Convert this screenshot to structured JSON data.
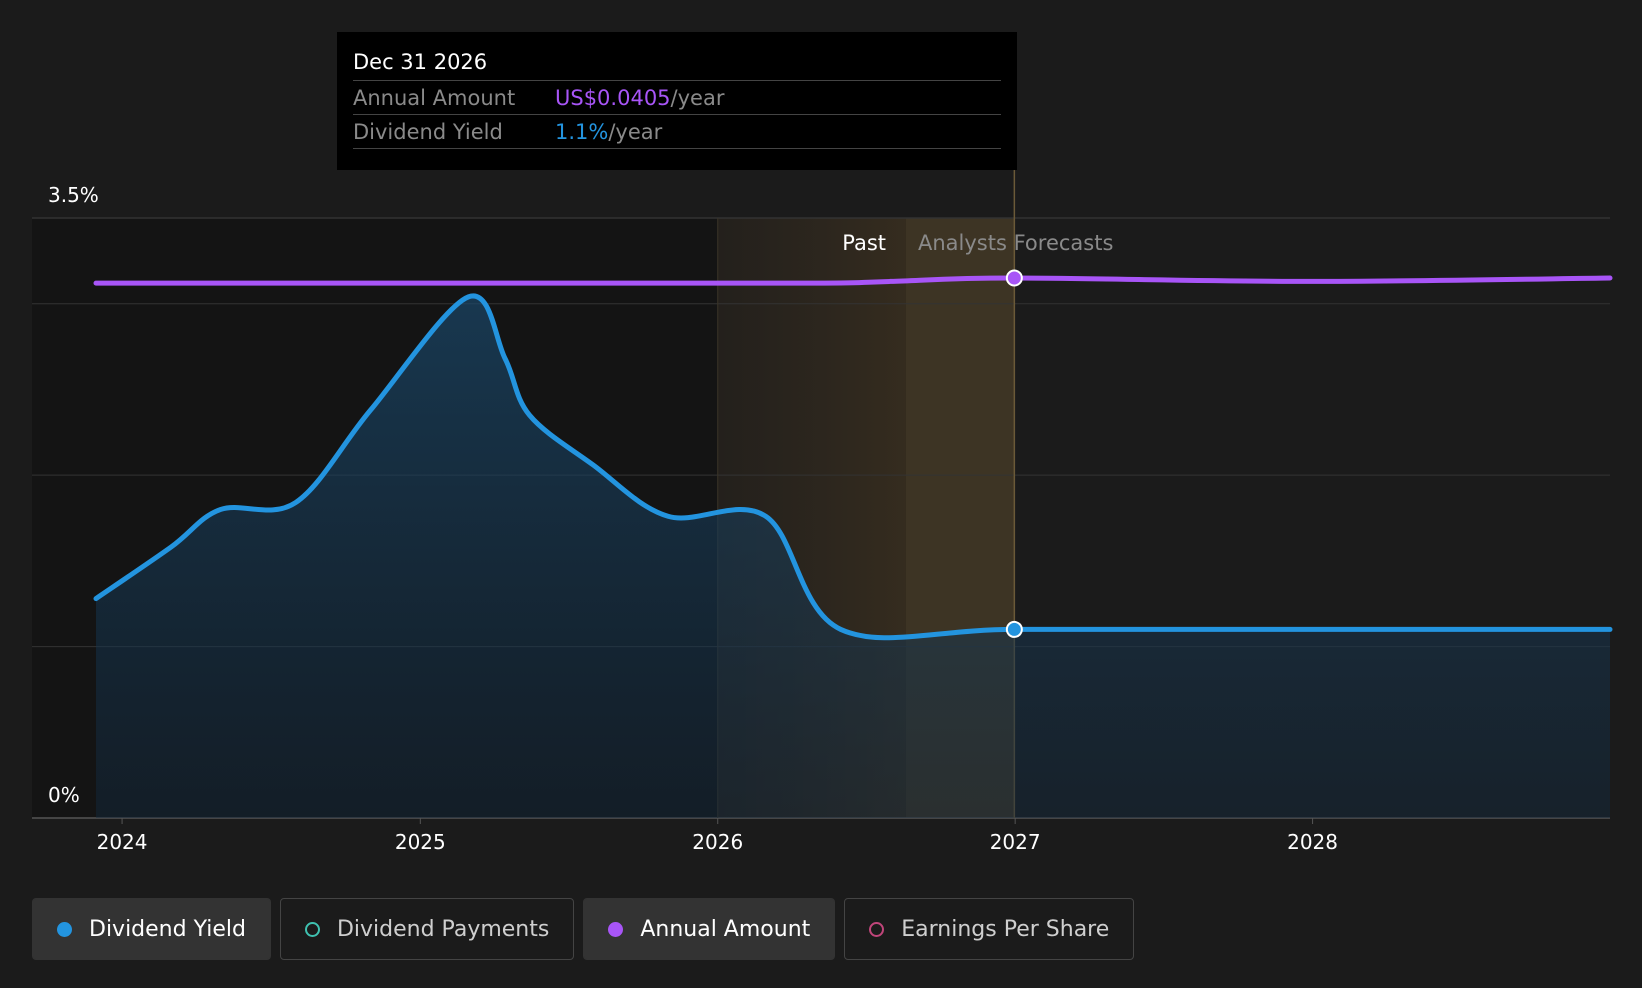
{
  "tooltip": {
    "date": "Dec 31 2026",
    "rows": [
      {
        "label": "Annual Amount",
        "value": "US$0.0405",
        "unit": "/year"
      },
      {
        "label": "Dividend Yield",
        "value": "1.1%",
        "unit": "/year"
      }
    ]
  },
  "regions": {
    "past_label": "Past",
    "forecast_label": "Analysts Forecasts"
  },
  "legend": [
    {
      "label": "Dividend Yield",
      "color": "#2394df",
      "filled": true,
      "active": true
    },
    {
      "label": "Dividend Payments",
      "color": "#3fc1b0",
      "filled": false,
      "active": false
    },
    {
      "label": "Annual Amount",
      "color": "#a855f7",
      "filled": true,
      "active": true
    },
    {
      "label": "Earnings Per Share",
      "color": "#c0457a",
      "filled": false,
      "active": false
    }
  ],
  "chart_data": {
    "type": "line",
    "y_axis": {
      "min": 0,
      "max": 3.5,
      "tick_labels": [
        "3.5%",
        "0%"
      ]
    },
    "x_axis": {
      "tick_labels": [
        "2024",
        "2025",
        "2026",
        "2027",
        "2028"
      ]
    },
    "x_range": [
      "2023-11-30",
      "2028-12-31"
    ],
    "past_cutoff": "2026-08-20",
    "forecast_highlight_end": "2026-12-31",
    "series": [
      {
        "name": "Dividend Yield",
        "color": "#2394df",
        "points": [
          [
            "2023-11-30",
            1.28
          ],
          [
            "2024-03-01",
            1.58
          ],
          [
            "2024-05-01",
            1.8
          ],
          [
            "2024-08-01",
            1.84
          ],
          [
            "2024-11-01",
            2.38
          ],
          [
            "2025-03-01",
            3.04
          ],
          [
            "2025-04-15",
            2.68
          ],
          [
            "2025-05-15",
            2.35
          ],
          [
            "2025-08-01",
            2.06
          ],
          [
            "2025-11-01",
            1.76
          ],
          [
            "2026-03-01",
            1.76
          ],
          [
            "2026-06-01",
            1.1
          ],
          [
            "2026-12-31",
            1.1
          ],
          [
            "2027-12-31",
            1.1
          ],
          [
            "2028-12-31",
            1.1
          ]
        ]
      },
      {
        "name": "Annual Amount",
        "color": "#a855f7",
        "points": [
          [
            "2023-11-30",
            3.12
          ],
          [
            "2025-06-01",
            3.12
          ],
          [
            "2026-05-01",
            3.12
          ],
          [
            "2026-08-01",
            3.13
          ],
          [
            "2026-12-31",
            3.15
          ],
          [
            "2027-12-31",
            3.13
          ],
          [
            "2028-12-31",
            3.15
          ]
        ]
      }
    ],
    "highlight_date": "2026-12-31"
  }
}
